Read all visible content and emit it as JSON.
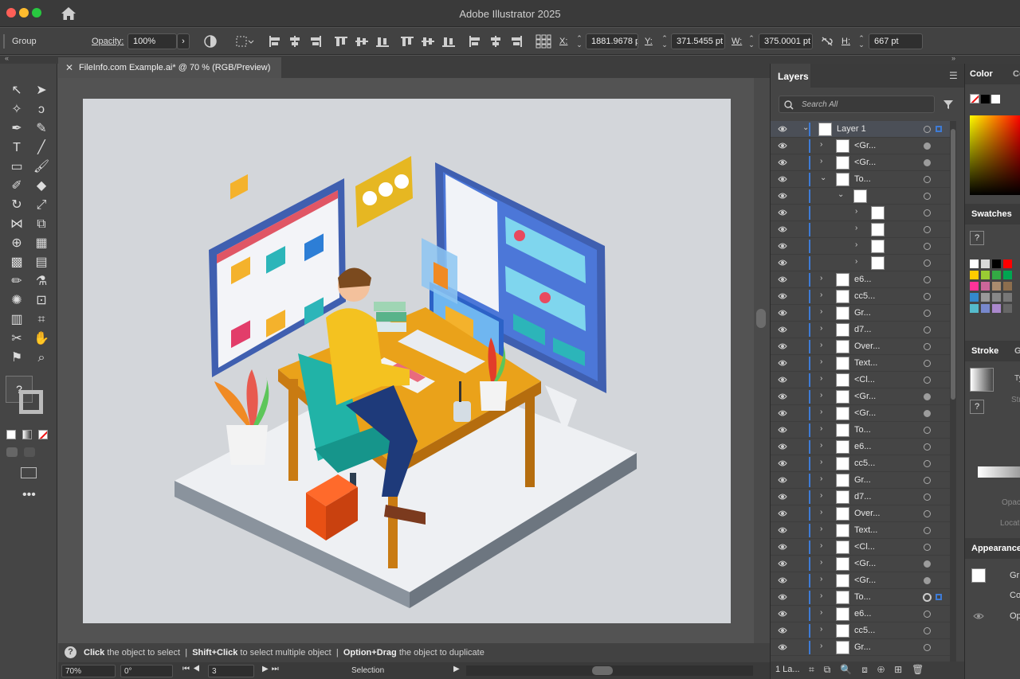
{
  "window": {
    "title": "Adobe Illustrator 2025"
  },
  "control_bar": {
    "selection_type": "Group",
    "opacity_label": "Opacity:",
    "opacity_value": "100%",
    "x_label": "X:",
    "x_value": "1881.9678 p",
    "y_label": "Y:",
    "y_value": "371.5455 pt",
    "w_label": "W:",
    "w_value": "375.0001 pt",
    "h_label": "H:",
    "h_value": "667 pt"
  },
  "document_tab": {
    "title": "FileInfo.com Example.ai* @ 70 % (RGB/Preview)"
  },
  "status_bar": {
    "click": "Click",
    "click_text": "the object to select",
    "shift": "Shift+Click",
    "shift_text": "to select multiple object",
    "option": "Option+Drag",
    "option_text": "the object to duplicate"
  },
  "bottom_bar": {
    "zoom": "70%",
    "rotation": "0°",
    "artboard": "3",
    "tool_status": "Selection"
  },
  "layers_panel": {
    "tab": "Layers",
    "search_placeholder": "Search All",
    "footer_count": "1 La...",
    "rows": [
      {
        "name": "Layer 1",
        "level": 0,
        "twirl": "open",
        "target": "ring",
        "selected": true
      },
      {
        "name": "<Gr...",
        "level": 1,
        "twirl": "closed",
        "target": "filled"
      },
      {
        "name": "<Gr...",
        "level": 1,
        "twirl": "closed",
        "target": "filled"
      },
      {
        "name": "To...",
        "level": 1,
        "twirl": "open",
        "target": "ring"
      },
      {
        "name": "",
        "level": 2,
        "twirl": "open",
        "target": "ring"
      },
      {
        "name": "",
        "level": 3,
        "twirl": "closed",
        "target": "ring"
      },
      {
        "name": "",
        "level": 3,
        "twirl": "closed",
        "target": "ring"
      },
      {
        "name": "",
        "level": 3,
        "twirl": "closed",
        "target": "ring"
      },
      {
        "name": "",
        "level": 3,
        "twirl": "closed",
        "target": "ring"
      },
      {
        "name": "e6...",
        "level": 1,
        "twirl": "closed",
        "target": "ring"
      },
      {
        "name": "cc5...",
        "level": 1,
        "twirl": "closed",
        "target": "ring"
      },
      {
        "name": "Gr...",
        "level": 1,
        "twirl": "closed",
        "target": "ring"
      },
      {
        "name": "d7...",
        "level": 1,
        "twirl": "closed",
        "target": "ring"
      },
      {
        "name": "Over...",
        "level": 1,
        "twirl": "closed",
        "target": "ring"
      },
      {
        "name": "Text...",
        "level": 1,
        "twirl": "closed",
        "target": "ring"
      },
      {
        "name": "<Cl...",
        "level": 1,
        "twirl": "closed",
        "target": "ring"
      },
      {
        "name": "<Gr...",
        "level": 1,
        "twirl": "closed",
        "target": "filled"
      },
      {
        "name": "<Gr...",
        "level": 1,
        "twirl": "closed",
        "target": "filled"
      },
      {
        "name": "To...",
        "level": 1,
        "twirl": "closed",
        "target": "ring"
      },
      {
        "name": "e6...",
        "level": 1,
        "twirl": "closed",
        "target": "ring"
      },
      {
        "name": "cc5...",
        "level": 1,
        "twirl": "closed",
        "target": "ring"
      },
      {
        "name": "Gr...",
        "level": 1,
        "twirl": "closed",
        "target": "ring"
      },
      {
        "name": "d7...",
        "level": 1,
        "twirl": "closed",
        "target": "ring"
      },
      {
        "name": "Over...",
        "level": 1,
        "twirl": "closed",
        "target": "ring"
      },
      {
        "name": "Text...",
        "level": 1,
        "twirl": "closed",
        "target": "ring"
      },
      {
        "name": "<Cl...",
        "level": 1,
        "twirl": "closed",
        "target": "ring"
      },
      {
        "name": "<Gr...",
        "level": 1,
        "twirl": "closed",
        "target": "filled"
      },
      {
        "name": "<Gr...",
        "level": 1,
        "twirl": "closed",
        "target": "filled"
      },
      {
        "name": "To...",
        "level": 1,
        "twirl": "closed",
        "target": "double",
        "selected_art": true
      },
      {
        "name": "e6...",
        "level": 1,
        "twirl": "closed",
        "target": "ring"
      },
      {
        "name": "cc5...",
        "level": 1,
        "twirl": "closed",
        "target": "ring"
      },
      {
        "name": "Gr...",
        "level": 1,
        "twirl": "closed",
        "target": "ring"
      }
    ]
  },
  "right_dock": {
    "color_tab": "Color",
    "color_tab_2": "Co",
    "swatches_tab": "Swatches",
    "stroke_tab": "Stroke",
    "stroke_tab_2": "G",
    "stroke_type_abbr": "Ty",
    "stroke_abbr": "Stro",
    "opacity_abbr": "Opac",
    "location_abbr": "Locati",
    "appearance_tab": "Appearance",
    "appearance_item": "Gr",
    "appearance_contents": "Co",
    "appearance_opacity": "Op"
  },
  "colors": {
    "accent": "#3e7bd6",
    "panel": "#454545",
    "canvas": "#535353"
  }
}
